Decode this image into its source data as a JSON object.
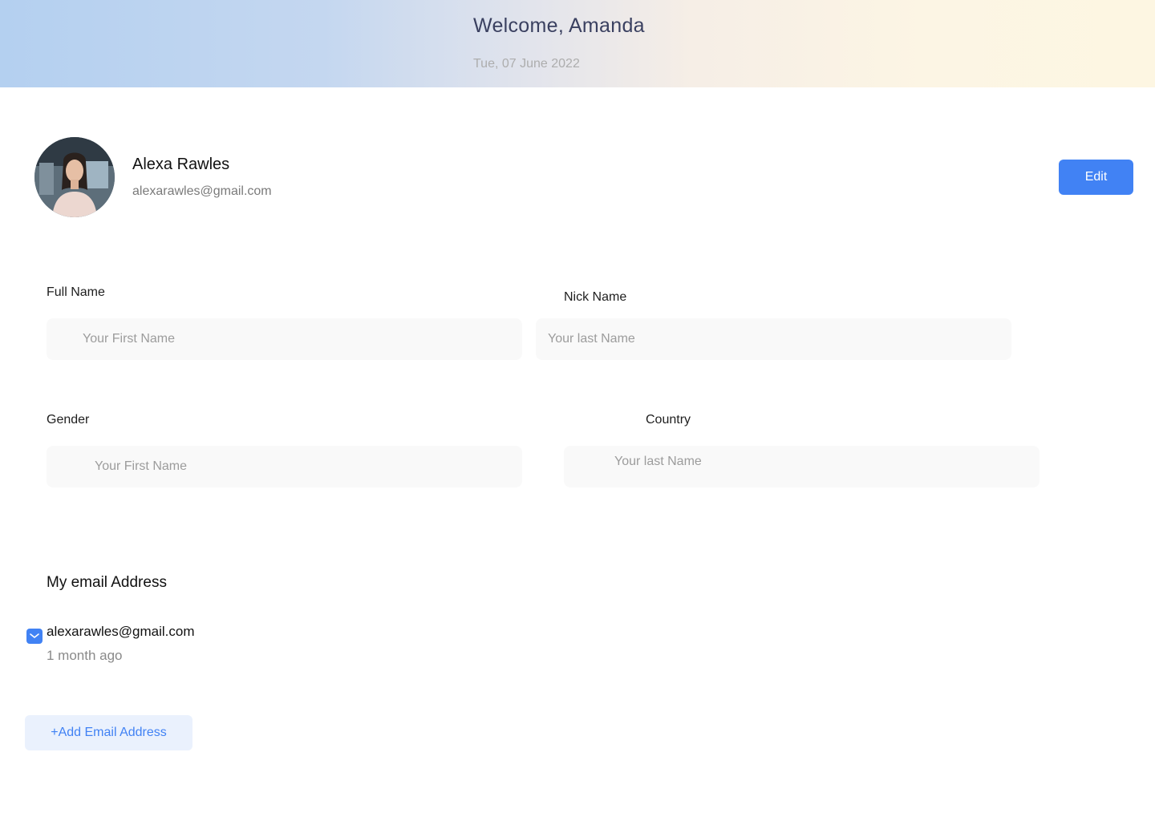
{
  "header": {
    "welcome": "Welcome, Amanda",
    "date": "Tue, 07 June 2022"
  },
  "profile": {
    "name": "Alexa Rawles",
    "email": "alexarawles@gmail.com",
    "edit_label": "Edit"
  },
  "form": {
    "full_name": {
      "label": "Full Name",
      "value": "",
      "placeholder": "Your First Name"
    },
    "nick_name": {
      "label": "Nick Name",
      "value": "",
      "placeholder": "Your last Name"
    },
    "gender": {
      "label": "Gender",
      "value": "",
      "placeholder": "Your First Name"
    },
    "country": {
      "label": "Country",
      "value": "",
      "placeholder": "Your last Name"
    }
  },
  "emails": {
    "title": "My email Address",
    "items": [
      {
        "icon": "mail-icon",
        "address": "alexarawles@gmail.com",
        "age": "1 month ago"
      }
    ],
    "add_label": "+Add Email Address"
  },
  "colors": {
    "accent": "#4182f4",
    "accent_soft": "#eaf1fd",
    "banner_left": "#b4d0f0",
    "banner_right": "#fdf6e2"
  }
}
